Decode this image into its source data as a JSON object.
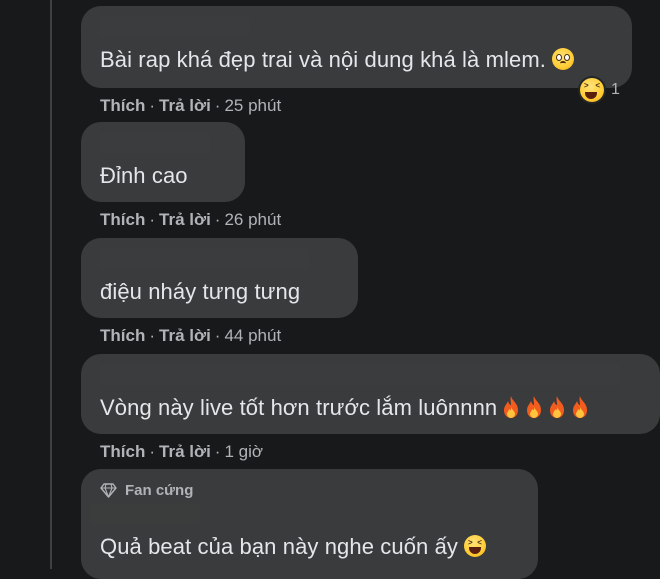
{
  "comments": [
    {
      "text": "Bài rap khá đẹp trai và nội dung khá là mlem.",
      "like_label": "Thích",
      "reply_label": "Trả lời",
      "time": "25 phút",
      "reaction_count": "1"
    },
    {
      "text": "Đỉnh cao",
      "like_label": "Thích",
      "reply_label": "Trả lời",
      "time": "26 phút"
    },
    {
      "text": "điệu nháy tưng tưng",
      "like_label": "Thích",
      "reply_label": "Trả lời",
      "time": "44 phút"
    },
    {
      "text": "Vòng này live tốt hơn trước lắm luônnnn",
      "like_label": "Thích",
      "reply_label": "Trả lời",
      "time": "1 giờ"
    },
    {
      "badge": "Fan cứng",
      "text": "Quả beat của bạn này nghe cuốn ấy"
    }
  ],
  "separator": "·",
  "icons": {
    "weary_face": "weary-face-emoji",
    "laughing_face": "laughing-face-emoji",
    "fire": "fire-emoji",
    "diamond": "diamond-icon"
  },
  "colors": {
    "background": "#18191a",
    "bubble": "#3a3b3c",
    "meta_text": "#b0b3b8",
    "body_text": "#e4e6eb"
  }
}
